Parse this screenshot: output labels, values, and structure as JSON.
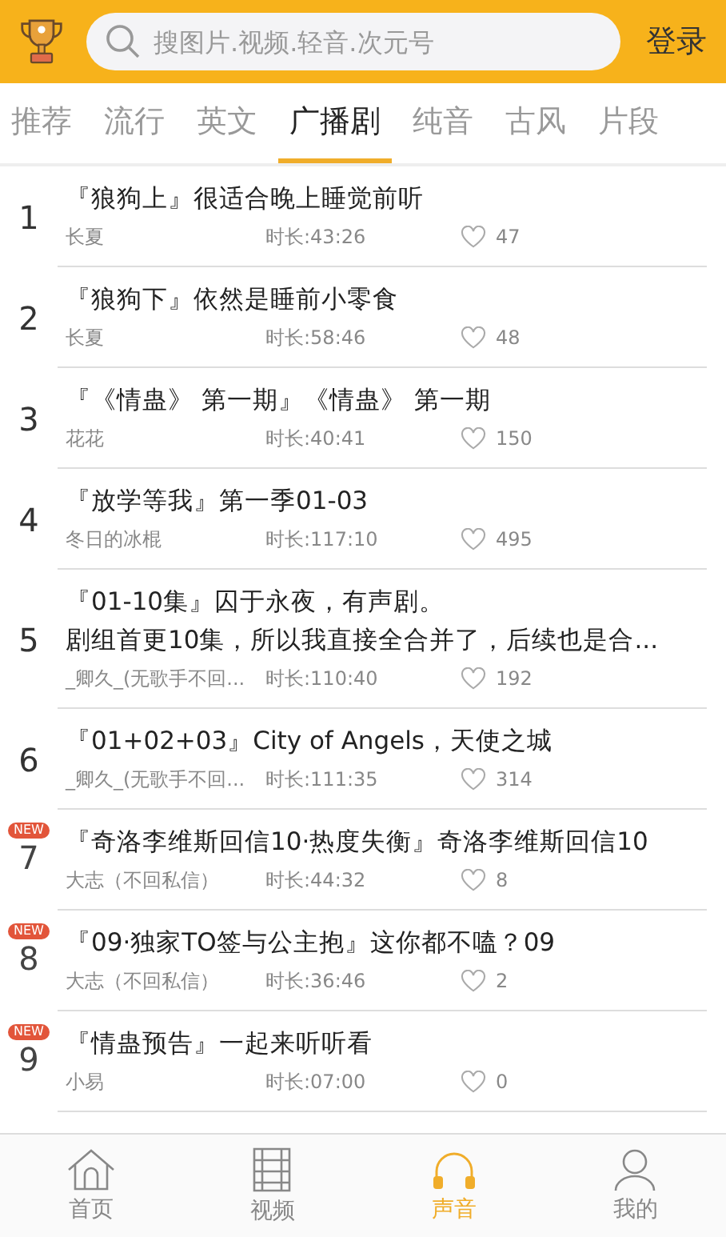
{
  "header": {
    "search": {
      "placeholder": "搜图片.视频.轻音.次元号"
    },
    "login": "登录"
  },
  "tabs": [
    {
      "label": "推荐",
      "selected": false
    },
    {
      "label": "流行",
      "selected": false
    },
    {
      "label": "英文",
      "selected": false
    },
    {
      "label": "广播剧",
      "selected": true
    },
    {
      "label": "纯音",
      "selected": false
    },
    {
      "label": "古风",
      "selected": false
    },
    {
      "label": "片段",
      "selected": false
    }
  ],
  "items": [
    {
      "rank": "1",
      "new": false,
      "title": "『狼狗上』很适合晚上睡觉前听",
      "author": "长夏",
      "duration": "时长:43:26",
      "likes": "47"
    },
    {
      "rank": "2",
      "new": false,
      "title": "『狼狗下』依然是睡前小零食",
      "author": "长夏",
      "duration": "时长:58:46",
      "likes": "48"
    },
    {
      "rank": "3",
      "new": false,
      "title": "『《情蛊》 第一期』《情蛊》 第一期",
      "author": "花花",
      "duration": "时长:40:41",
      "likes": "150"
    },
    {
      "rank": "4",
      "new": false,
      "title": "『放学等我』第一季01-03",
      "author": "冬日的冰棍",
      "duration": "时长:117:10",
      "likes": "495"
    },
    {
      "rank": "5",
      "new": false,
      "title_lines": [
        "『01-10集』囚于永夜，有声剧。",
        "剧组首更10集，所以我直接全合并了，后续也是合..."
      ],
      "author": "_卿久_(无歌手不回...",
      "duration": "时长:110:40",
      "likes": "192"
    },
    {
      "rank": "6",
      "new": false,
      "title": "『01+02+03』City of Angels，天使之城",
      "author": "_卿久_(无歌手不回...",
      "duration": "时长:111:35",
      "likes": "314"
    },
    {
      "rank": "7",
      "new": true,
      "badge": "NEW",
      "title": "『奇洛李维斯回信10·热度失衡』奇洛李维斯回信10",
      "author": "大志（不回私信）",
      "duration": "时长:44:32",
      "likes": "8"
    },
    {
      "rank": "8",
      "new": true,
      "badge": "NEW",
      "title": "『09·独家TO签与公主抱』这你都不嗑？09",
      "author": "大志（不回私信）",
      "duration": "时长:36:46",
      "likes": "2"
    },
    {
      "rank": "9",
      "new": true,
      "badge": "NEW",
      "title": "『情蛊预告』一起来听听看",
      "author": "小易",
      "duration": "时长:07:00",
      "likes": "0"
    }
  ],
  "nav": [
    {
      "kind": "home",
      "label": "首页",
      "selected": false
    },
    {
      "kind": "video",
      "label": "视频",
      "selected": false
    },
    {
      "kind": "audio",
      "label": "声音",
      "selected": true
    },
    {
      "kind": "me",
      "label": "我的",
      "selected": false
    }
  ]
}
